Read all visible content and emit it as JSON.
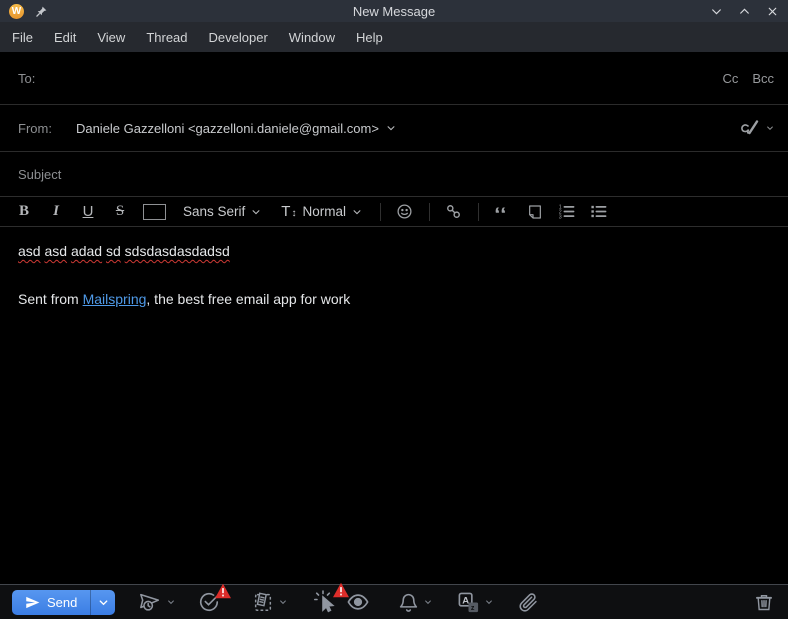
{
  "titlebar": {
    "title": "New Message"
  },
  "menubar": {
    "items": [
      "File",
      "Edit",
      "View",
      "Thread",
      "Developer",
      "Window",
      "Help"
    ]
  },
  "compose": {
    "to_label": "To:",
    "cc_label": "Cc",
    "bcc_label": "Bcc",
    "from_label": "From:",
    "from_value": "Daniele Gazzelloni <gazzelloni.daniele@gmail.com>",
    "subject_placeholder": "Subject"
  },
  "format_toolbar": {
    "bold_label": "B",
    "italic_label": "I",
    "underline_label": "U",
    "strikethrough_label": "S",
    "font_family_value": "Sans Serif",
    "paragraph_style_value": "Normal"
  },
  "body": {
    "line1_words": [
      "asd",
      "asd",
      "adad",
      "sd",
      "sdsdasdasdadsd"
    ],
    "signature_prefix": "Sent from ",
    "signature_link": "Mailspring",
    "signature_suffix": ", the best free email app for work"
  },
  "footer": {
    "send_label": "Send"
  },
  "icons": {
    "app": "mailspring-w-logo",
    "footer": [
      "send-later",
      "reminder-check",
      "template",
      "link-tracking",
      "open-tracking-eye",
      "notifications-bell",
      "translate",
      "attach-paperclip",
      "trash"
    ]
  },
  "colors": {
    "titlebar_bg": "#2c313a",
    "menubar_bg": "#26292f",
    "body_bg": "#000000",
    "accent_blue": "#3b7de4",
    "link_blue": "#4f9ae8",
    "spellcheck_red": "#ce3a35",
    "warning_red": "#dd2d2a",
    "app_icon_orange": "#e8962f"
  }
}
